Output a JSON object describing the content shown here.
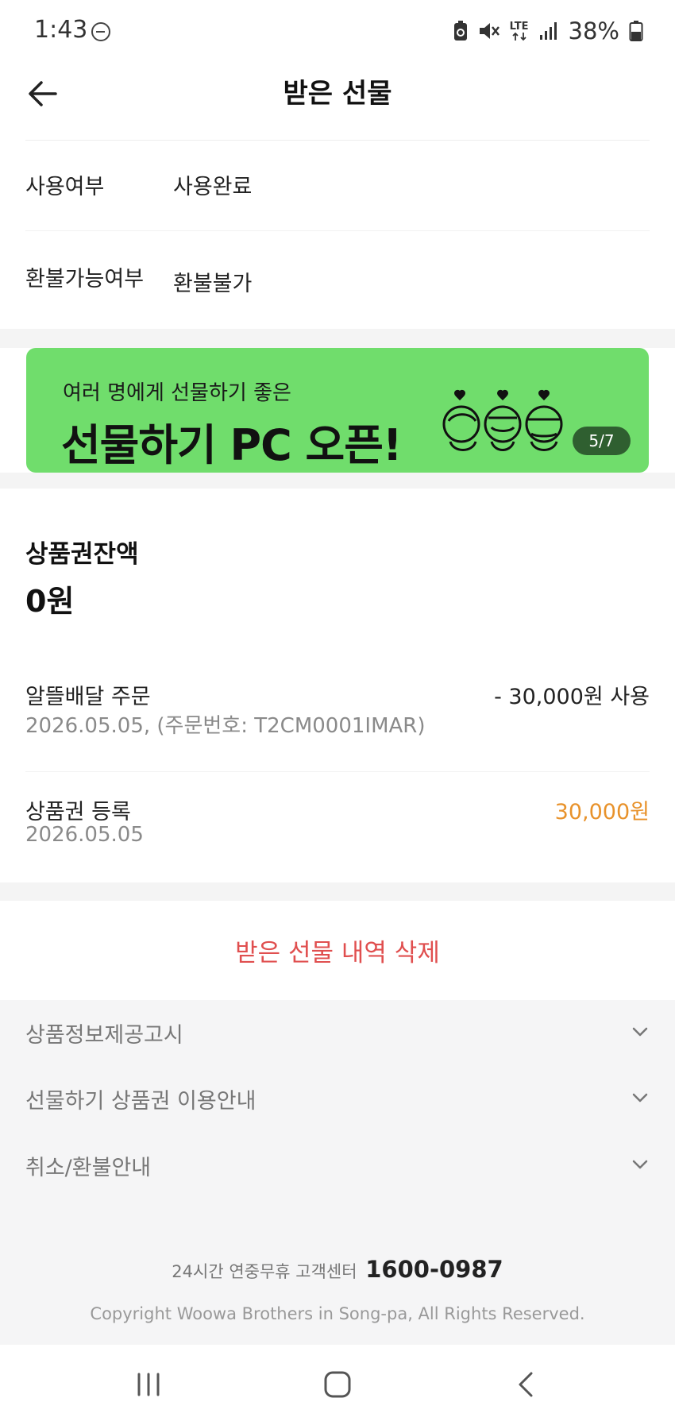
{
  "status_bar": {
    "time": "1:43",
    "signal_label": "LTE",
    "battery_percent": "38%",
    "icons": [
      "do-not-disturb-icon",
      "battery-saver-icon",
      "mute-icon",
      "lte-icon",
      "signal-icon",
      "battery-icon"
    ]
  },
  "header": {
    "title": "받은 선물",
    "back_icon": "arrow-left-icon"
  },
  "details": [
    {
      "label": "사용여부",
      "value": "사용완료"
    },
    {
      "label": "환불가능여부",
      "value": "환불불가"
    }
  ],
  "banner": {
    "subtitle": "여러 명에게 선물하기 좋은",
    "title": "선물하기 PC 오픈!",
    "counter": "5/7",
    "background_color": "#70dd6c"
  },
  "balance": {
    "label": "상품권잔액",
    "value": "0원"
  },
  "transactions": [
    {
      "title": "알뜰배달 주문",
      "subtitle": "2026.05.05, (주문번호: T2CM0001IMAR)",
      "amount": "- 30,000원 사용"
    },
    {
      "title": "상품권 등록",
      "subtitle": "2026.05.05",
      "amount": "30,000원",
      "amount_color": "#e8922b"
    }
  ],
  "delete_button": {
    "label": "받은 선물 내역 삭제",
    "color": "#e04f4f"
  },
  "accordions": [
    {
      "label": "상품정보제공고시"
    },
    {
      "label": "선물하기 상품권 이용안내"
    },
    {
      "label": "취소/환불안내"
    }
  ],
  "footer": {
    "cs_text": "24시간 연중무휴 고객센터",
    "cs_phone": "1600-0987",
    "copyright": "Copyright Woowa Brothers in Song-pa, All Rights Reserved."
  },
  "nav_bar": {
    "icons": [
      "recent-apps-icon",
      "home-icon",
      "back-icon"
    ]
  }
}
